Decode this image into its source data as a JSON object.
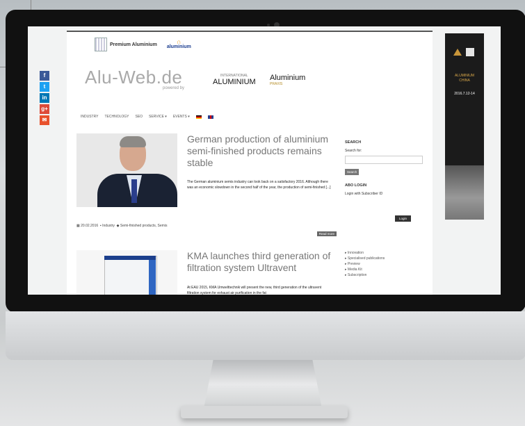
{
  "topbar": {
    "premium_label": "Premium Aluminium",
    "alu_logo": "aluminium"
  },
  "banner": {
    "site_title": "Alu-Web.de",
    "powered_by": "powered by",
    "logo1_main": "ALUMINIUM",
    "logo1_sub": "INTERNATIONAL",
    "logo2_main": "Aluminium",
    "logo2_sub": "PRAXIS"
  },
  "nav": {
    "items": [
      "INDUSTRY",
      "TECHNOLOGY",
      "SEO",
      "SERVICE ▾",
      "EVENTS ▾"
    ]
  },
  "social": {
    "icons": [
      "f",
      "t",
      "in",
      "g+",
      "✉"
    ]
  },
  "posts": [
    {
      "title": "German production of aluminium semi-finished products remains stable",
      "excerpt": "The German aluminium semis industry can look back on a satisfactory 2016. Although there was an economic slowdown in the second half of the year, the production of semi-finished [...]",
      "date": "20.02.2016",
      "category": "Industry",
      "tags": "Semi-finished products, Semis",
      "read_more": "Read more"
    },
    {
      "title": "KMA launches third generation of filtration system Ultravent",
      "excerpt": "At EAU 2015, KMA Umwelttechnik will present the new, third generation of the ultravent filtration system for exhaust air purification in the fat",
      "date": "",
      "category": "",
      "tags": "",
      "read_more": ""
    }
  ],
  "sidebar": {
    "search_heading": "SEARCH",
    "search_for": "Search for:",
    "search_button": "Search",
    "login_heading": "ABO LOGIN",
    "login_text": "Login with Subscriber ID",
    "login_button": "Login",
    "links": [
      "Innovation",
      "Specialised publications",
      "Preview",
      "Media Kit",
      "Subscription"
    ]
  },
  "ad": {
    "line1": "ALUMINIUM",
    "line2": "CHINA",
    "date": "2016.7.12-14"
  }
}
